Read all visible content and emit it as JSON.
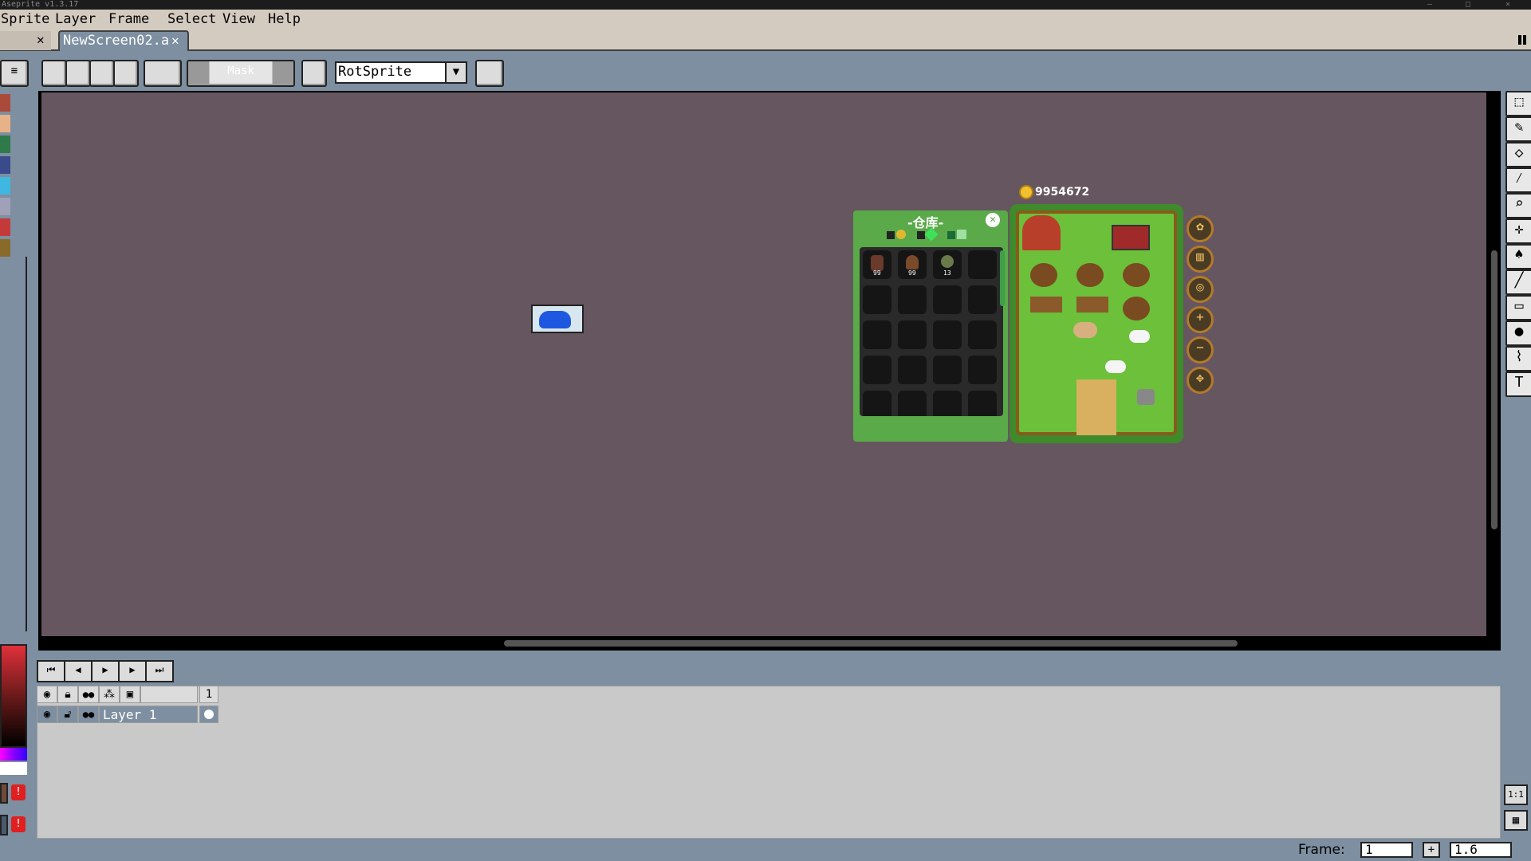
{
  "window": {
    "title": "Aseprite v1.3.17"
  },
  "menu": [
    {
      "label": "Sprite"
    },
    {
      "label": "Layer"
    },
    {
      "label": "Frame"
    },
    {
      "label": "Select"
    },
    {
      "label": "View"
    },
    {
      "label": "Help"
    }
  ],
  "tabs": {
    "active": "NewScreen02.a",
    "close_symbol": "✕"
  },
  "toolbar": {
    "mask_label": "Mask",
    "rotation_algorithm": "RotSprite"
  },
  "palette_colors": [
    "#a94a3a",
    "#e8b288",
    "#2e7a4a",
    "#3a4a8a",
    "#3fb7e0",
    "#a0a0b8",
    "#c43a3a",
    "#8a6a2a"
  ],
  "game": {
    "coins": "9954672",
    "warehouse_title": "-仓库-",
    "slot_counts": [
      "99",
      "99",
      "13"
    ]
  },
  "timeline": {
    "frame_number_header": "1",
    "layer_name": "Layer 1"
  },
  "statusbar": {
    "frame_label": "Frame:",
    "frame_value": "1",
    "zoom_value": "1.6"
  }
}
